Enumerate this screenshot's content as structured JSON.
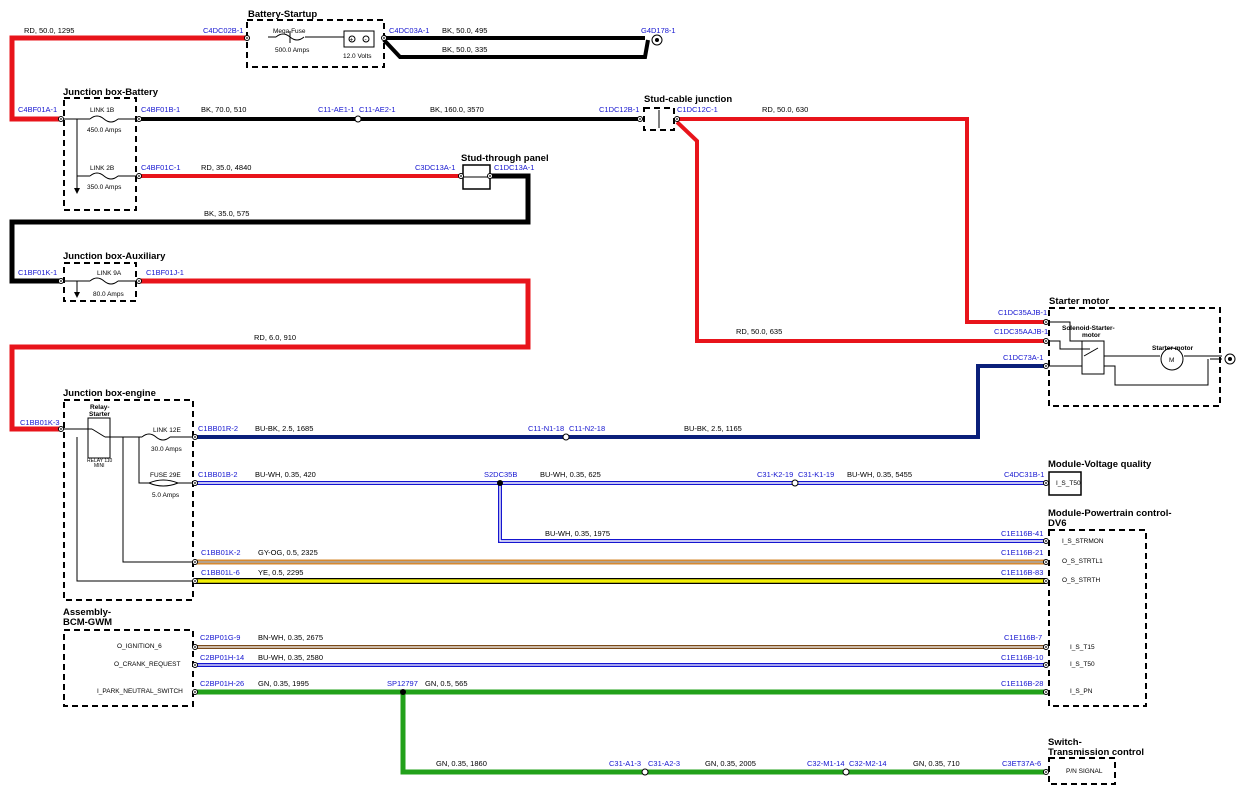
{
  "colors": {
    "red": "#e8141b",
    "black": "#000000",
    "navy": "#0a1f7a",
    "blue": "#1515d0",
    "green": "#22a11a",
    "brown": "#7a4a1a",
    "orange": "#d6892f",
    "yellow": "#f2ef06"
  },
  "components": {
    "battery_startup": "Battery-Startup",
    "mega_fuse": "Mega Fuse",
    "mega_fuse_rating": "500.0 Amps",
    "battery_voltage": "12.0 Volts",
    "jb_battery": "Junction box-Battery",
    "link_1b": "LINK 1B",
    "link_1b_rating": "450.0 Amps",
    "link_2b": "LINK 2B",
    "link_2b_rating": "350.0 Amps",
    "stud_cable": "Stud-cable junction",
    "stud_through": "Stud-through panel",
    "jb_aux": "Junction box-Auxiliary",
    "link_9a": "LINK 9A",
    "link_9a_rating": "80.0 Amps",
    "starter_motor": "Starter motor",
    "solenoid": "Solenoid-Starter-",
    "solenoid2": "motor",
    "starter_motor_label": "Starter motor",
    "motor_symbol": "M",
    "jb_engine": "Junction box-engine",
    "relay": "Relay-",
    "relay2": "Starter",
    "relay_type": "RELAY 110",
    "relay_type2": "MINI",
    "link_12e": "LINK 12E",
    "link_12e_rating": "30.0 Amps",
    "fuse_29e": "FUSE 29E",
    "fuse_29e_rating": "5.0 Amps",
    "module_vq": "Module-Voltage quality",
    "module_pcm": "Module-Powertrain control-",
    "module_pcm2": "DV6",
    "bcm": "Assembly-",
    "bcm2": "BCM-GWM",
    "switch_tc": "Switch-",
    "switch_tc2": "Transmission control"
  },
  "pins": {
    "vq_i_s_t50": "I_S_T50",
    "pcm_strmon": "I_S_STRMON",
    "pcm_strtl1": "O_S_STRTL1",
    "pcm_strth": "O_S_STRTH",
    "pcm_t15": "I_S_T15",
    "pcm_t50": "I_S_T50",
    "pcm_pn": "I_S_PN",
    "bcm_ign": "O_IGNITION_6",
    "bcm_crank": "O_CRANK_REQUEST",
    "bcm_park": "I_PARK_NEUTRAL_SWITCH",
    "switch_pn": "P/N SIGNAL"
  },
  "connectors": {
    "c4dc02b1": "C4DC02B-1",
    "c4dc03a1": "C4DC03A-1",
    "g4d1781": "G4D178-1",
    "c4bf01a1": "C4BF01A-1",
    "c4bf01b1": "C4BF01B-1",
    "c11ae11": "C11-AE1-1",
    "c11ae21": "C11-AE2-1",
    "c1dc12b1": "C1DC12B-1",
    "c1dc12c1": "C1DC12C-1",
    "c4bf01c1": "C4BF01C-1",
    "c3dc13a1": "C3DC13A-1",
    "c1dc13a1": "C1DC13A-1",
    "c1bf01k1": "C1BF01K-1",
    "c1bf01j1": "C1BF01J-1",
    "c1dc35ajb1": "C1DC35AJB-1",
    "c1dc35aajb1": "C1DC35AAJB-1",
    "c1dc73a1": "C1DC73A-1",
    "c1bb01k3": "C1BB01K-3",
    "c1bb01r2": "C1BB01R-2",
    "c11n118": "C11-N1-18",
    "c11n218": "C11-N2-18",
    "c1bb01b2": "C1BB01B-2",
    "s2dc35b": "S2DC35B",
    "c31k219": "C31-K2-19",
    "c31k119": "C31-K1-19",
    "c4dc31b1": "C4DC31B-1",
    "c1e116b41": "C1E116B-41",
    "c1bb01k2": "C1BB01K-2",
    "c1e116b21": "C1E116B-21",
    "c1bb01l6": "C1BB01L-6",
    "c1e116b83": "C1E116B-83",
    "c2bp01g9": "C2BP01G-9",
    "c1e116b7": "C1E116B-7",
    "c2bp01h14": "C2BP01H-14",
    "c1e116b10": "C1E116B-10",
    "c2bp01h26": "C2BP01H-26",
    "sp12797": "SP12797",
    "c1e116b28": "C1E116B-28",
    "c31a13": "C31-A1-3",
    "c31a23": "C31-A2-3",
    "c32m114": "C32-M1-14",
    "c32m214": "C32-M2-14",
    "c3et37a6": "C3ET37A-6"
  },
  "wires": {
    "w1": "RD,  50.0,  1295",
    "w2": "BK,  50.0,  495",
    "w3": "BK,  50.0,  335",
    "w4": "BK,  70.0,  510",
    "w5": "BK,  160.0,  3570",
    "w6": "RD,  50.0,  630",
    "w7": "RD,  35.0,  4840",
    "w8": "BK,  35.0,  575",
    "w9": "RD,  50.0,  635",
    "w10": "RD,  6.0,  910",
    "w11": "BU-BK,  2.5,  1685",
    "w12": "BU-BK,  2.5,  1165",
    "w13": "BU-WH,  0.35,  420",
    "w14": "BU-WH,  0.35,  625",
    "w15": "BU-WH,  0.35,  5455",
    "w16": "BU-WH,  0.35,  1975",
    "w17": "GY-OG,  0.5,  2325",
    "w18": "YE,  0.5,  2295",
    "w19": "BN-WH,  0.35,  2675",
    "w20": "BU-WH,  0.35,  2580",
    "w21": "GN,  0.35,  1995",
    "w22": "GN,  0.5,  565",
    "w23": "GN,  0.35,  1860",
    "w24": "GN,  0.35,  2005",
    "w25": "GN,  0.35,  710"
  }
}
